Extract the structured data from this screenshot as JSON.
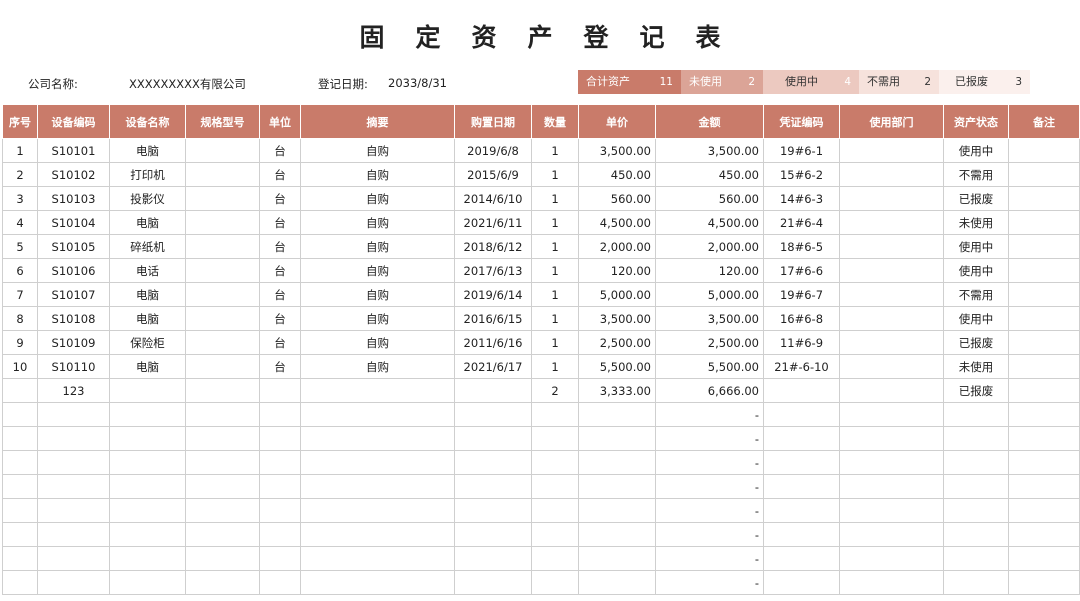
{
  "title": "固定资产登记表",
  "company_label": "公司名称:",
  "company_value": "XXXXXXXXX有限公司",
  "date_label": "登记日期:",
  "date_value": "2033/8/31",
  "summary": {
    "total_label": "合计资产",
    "total_value": "11",
    "unused_label": "未使用",
    "unused_value": "2",
    "inuse_label": "使用中",
    "inuse_value": "4",
    "notneeded_label": "不需用",
    "notneeded_value": "2",
    "scrapped_label": "已报废",
    "scrapped_value": "3"
  },
  "columns": [
    "序号",
    "设备编码",
    "设备名称",
    "规格型号",
    "单位",
    "摘要",
    "购置日期",
    "数量",
    "单价",
    "金额",
    "凭证编码",
    "使用部门",
    "资产状态",
    "备注"
  ],
  "rows": [
    [
      "1",
      "S10101",
      "电脑",
      "",
      "台",
      "自购",
      "2019/6/8",
      "1",
      "3,500.00",
      "3,500.00",
      "19#6-1",
      "",
      "使用中",
      ""
    ],
    [
      "2",
      "S10102",
      "打印机",
      "",
      "台",
      "自购",
      "2015/6/9",
      "1",
      "450.00",
      "450.00",
      "15#6-2",
      "",
      "不需用",
      ""
    ],
    [
      "3",
      "S10103",
      "投影仪",
      "",
      "台",
      "自购",
      "2014/6/10",
      "1",
      "560.00",
      "560.00",
      "14#6-3",
      "",
      "已报废",
      ""
    ],
    [
      "4",
      "S10104",
      "电脑",
      "",
      "台",
      "自购",
      "2021/6/11",
      "1",
      "4,500.00",
      "4,500.00",
      "21#6-4",
      "",
      "未使用",
      ""
    ],
    [
      "5",
      "S10105",
      "碎纸机",
      "",
      "台",
      "自购",
      "2018/6/12",
      "1",
      "2,000.00",
      "2,000.00",
      "18#6-5",
      "",
      "使用中",
      ""
    ],
    [
      "6",
      "S10106",
      "电话",
      "",
      "台",
      "自购",
      "2017/6/13",
      "1",
      "120.00",
      "120.00",
      "17#6-6",
      "",
      "使用中",
      ""
    ],
    [
      "7",
      "S10107",
      "电脑",
      "",
      "台",
      "自购",
      "2019/6/14",
      "1",
      "5,000.00",
      "5,000.00",
      "19#6-7",
      "",
      "不需用",
      ""
    ],
    [
      "8",
      "S10108",
      "电脑",
      "",
      "台",
      "自购",
      "2016/6/15",
      "1",
      "3,500.00",
      "3,500.00",
      "16#6-8",
      "",
      "使用中",
      ""
    ],
    [
      "9",
      "S10109",
      "保险柜",
      "",
      "台",
      "自购",
      "2011/6/16",
      "1",
      "2,500.00",
      "2,500.00",
      "11#6-9",
      "",
      "已报废",
      ""
    ],
    [
      "10",
      "S10110",
      "电脑",
      "",
      "台",
      "自购",
      "2021/6/17",
      "1",
      "5,500.00",
      "5,500.00",
      "21#-6-10",
      "",
      "未使用",
      ""
    ],
    [
      "",
      "123",
      "",
      "",
      "",
      "",
      "",
      "2",
      "3,333.00",
      "6,666.00",
      "",
      "",
      "已报废",
      ""
    ],
    [
      "",
      "",
      "",
      "",
      "",
      "",
      "",
      "",
      "",
      "-",
      "",
      "",
      "",
      ""
    ],
    [
      "",
      "",
      "",
      "",
      "",
      "",
      "",
      "",
      "",
      "-",
      "",
      "",
      "",
      ""
    ],
    [
      "",
      "",
      "",
      "",
      "",
      "",
      "",
      "",
      "",
      "-",
      "",
      "",
      "",
      ""
    ],
    [
      "",
      "",
      "",
      "",
      "",
      "",
      "",
      "",
      "",
      "-",
      "",
      "",
      "",
      ""
    ],
    [
      "",
      "",
      "",
      "",
      "",
      "",
      "",
      "",
      "",
      "-",
      "",
      "",
      "",
      ""
    ],
    [
      "",
      "",
      "",
      "",
      "",
      "",
      "",
      "",
      "",
      "-",
      "",
      "",
      "",
      ""
    ],
    [
      "",
      "",
      "",
      "",
      "",
      "",
      "",
      "",
      "",
      "-",
      "",
      "",
      "",
      ""
    ],
    [
      "",
      "",
      "",
      "",
      "",
      "",
      "",
      "",
      "",
      "-",
      "",
      "",
      "",
      ""
    ]
  ],
  "colors": {
    "header_bg": "#c97b6a",
    "grid_line": "#cfcfcf"
  }
}
